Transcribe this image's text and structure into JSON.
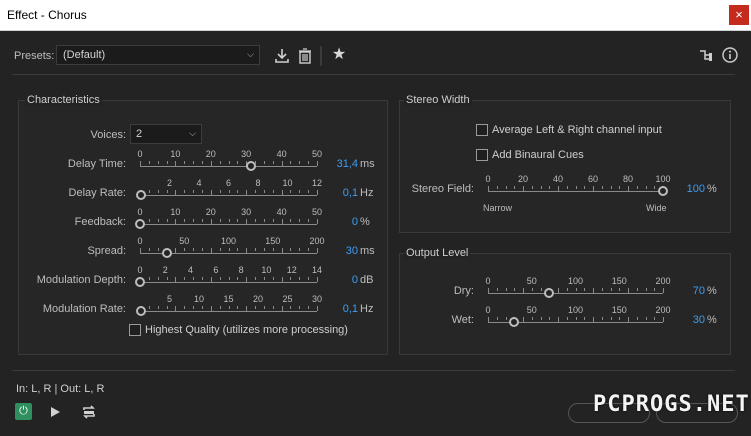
{
  "window": {
    "title": "Effect - Chorus",
    "close_glyph": "×"
  },
  "presets": {
    "label": "Presets:",
    "value": "(Default)"
  },
  "toolbar_icons": [
    "save-preset-icon",
    "delete-preset-icon",
    "favorite-star-icon",
    "routing-icon",
    "info-icon"
  ],
  "characteristics": {
    "title": "Characteristics",
    "voices": {
      "label": "Voices:",
      "value": "2"
    },
    "sliders": [
      {
        "label": "Delay Time:",
        "ticks": [
          "0",
          "10",
          "20",
          "30",
          "40",
          "50"
        ],
        "min": 0,
        "max": 50,
        "value": 31.4,
        "display": "31,4",
        "unit": "ms"
      },
      {
        "label": "Delay Rate:",
        "ticks": [
          "2",
          "4",
          "6",
          "8",
          "10",
          "12"
        ],
        "min": 0,
        "max": 12,
        "value": 0.1,
        "display": "0,1",
        "unit": "Hz"
      },
      {
        "label": "Feedback:",
        "ticks": [
          "0",
          "10",
          "20",
          "30",
          "40",
          "50"
        ],
        "min": 0,
        "max": 50,
        "value": 0,
        "display": "0",
        "unit": "%"
      },
      {
        "label": "Spread:",
        "ticks": [
          "0",
          "50",
          "100",
          "150",
          "200"
        ],
        "min": 0,
        "max": 200,
        "value": 30,
        "display": "30",
        "unit": "ms"
      },
      {
        "label": "Modulation Depth:",
        "ticks": [
          "0",
          "2",
          "4",
          "6",
          "8",
          "10",
          "12",
          "14"
        ],
        "min": 0,
        "max": 14,
        "value": 0,
        "display": "0",
        "unit": "dB"
      },
      {
        "label": "Modulation Rate:",
        "ticks": [
          "5",
          "10",
          "15",
          "20",
          "25",
          "30"
        ],
        "min": 0,
        "max": 30,
        "value": 0.1,
        "display": "0,1",
        "unit": "Hz"
      }
    ],
    "highest_quality": {
      "label": "Highest Quality (utilizes more processing)",
      "checked": false
    }
  },
  "stereo_width": {
    "title": "Stereo Width",
    "average_lr": {
      "label": "Average Left & Right channel input",
      "checked": false
    },
    "binaural": {
      "label": "Add Binaural Cues",
      "checked": false
    },
    "field": {
      "label": "Stereo Field:",
      "ticks": [
        "0",
        "20",
        "40",
        "60",
        "80",
        "100"
      ],
      "min": 0,
      "max": 100,
      "value": 100,
      "display": "100",
      "unit": "%",
      "left_caption": "Narrow",
      "right_caption": "Wide"
    }
  },
  "output_level": {
    "title": "Output Level",
    "sliders": [
      {
        "label": "Dry:",
        "ticks": [
          "0",
          "50",
          "100",
          "150",
          "200"
        ],
        "min": 0,
        "max": 200,
        "value": 70,
        "display": "70",
        "unit": "%"
      },
      {
        "label": "Wet:",
        "ticks": [
          "0",
          "50",
          "100",
          "150",
          "200"
        ],
        "min": 0,
        "max": 200,
        "value": 30,
        "display": "30",
        "unit": "%"
      }
    ]
  },
  "footer": {
    "io_text": "In: L, R | Out: L, R"
  },
  "watermark": "PCPROGS.NET"
}
